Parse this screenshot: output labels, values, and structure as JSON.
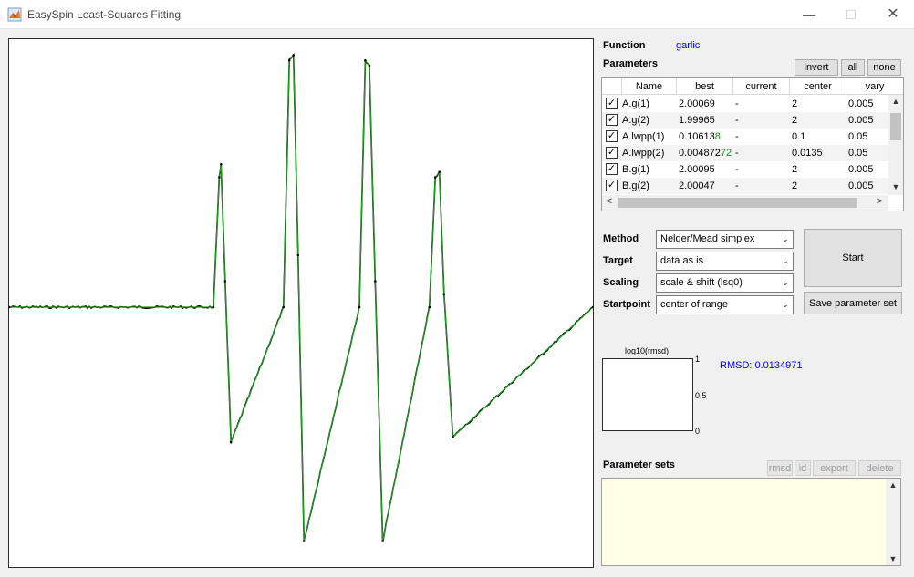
{
  "window": {
    "title": "EasySpin Least-Squares Fitting",
    "minimize": "—",
    "maximize": "☐",
    "close": "✕"
  },
  "function": {
    "label": "Function",
    "value": "garlic"
  },
  "parameters": {
    "label": "Parameters",
    "buttons": {
      "invert": "invert",
      "all": "all",
      "none": "none"
    },
    "columns": [
      "Name",
      "best",
      "current",
      "center",
      "vary"
    ],
    "rows": [
      {
        "checked": true,
        "name": "A.g(1)",
        "best": "2.00069",
        "best_changed": "",
        "current": "-",
        "center": "2",
        "vary": "0.005"
      },
      {
        "checked": true,
        "name": "A.g(2)",
        "best": "1.99965",
        "best_changed": "",
        "current": "-",
        "center": "2",
        "vary": "0.005"
      },
      {
        "checked": true,
        "name": "A.lwpp(1)",
        "best": "0.10613",
        "best_changed": "8",
        "current": "-",
        "center": "0.1",
        "vary": "0.05"
      },
      {
        "checked": true,
        "name": "A.lwpp(2)",
        "best": "0.004872",
        "best_changed": "72",
        "current": "-",
        "center": "0.0135",
        "vary": "0.05"
      },
      {
        "checked": true,
        "name": "B.g(1)",
        "best": "2.00095",
        "best_changed": "",
        "current": "-",
        "center": "2",
        "vary": "0.005"
      },
      {
        "checked": true,
        "name": "B.g(2)",
        "best": "2.00047",
        "best_changed": "",
        "current": "-",
        "center": "2",
        "vary": "0.005"
      }
    ]
  },
  "settings": {
    "method": {
      "label": "Method",
      "value": "Nelder/Mead simplex"
    },
    "target": {
      "label": "Target",
      "value": "data as is"
    },
    "scaling": {
      "label": "Scaling",
      "value": "scale & shift (lsq0)"
    },
    "startpoint": {
      "label": "Startpoint",
      "value": "center of range"
    }
  },
  "actions": {
    "start": "Start",
    "save": "Save parameter set"
  },
  "rmsd_plot": {
    "title": "log10(rmsd)",
    "ticks": [
      "1",
      "0.5",
      "0"
    ],
    "readout": "RMSD: 0.0134971"
  },
  "parameter_sets": {
    "label": "Parameter sets",
    "buttons": {
      "rmsd": "rmsd",
      "id": "id",
      "export": "export",
      "delete": "delete"
    }
  },
  "icons": {
    "app": "matlab-logo-icon",
    "check": "✓",
    "chevron_down": "⌄",
    "arrow_up": "▲",
    "arrow_down": "▼",
    "arrow_left": "<",
    "arrow_right": ">"
  },
  "colors": {
    "fit": "#1e9e1e",
    "data": "#000000",
    "blue_text": "#0000ff",
    "changed_digits": "#1a8a1a",
    "psets_bg": "#ffffe8"
  },
  "chart_data": {
    "type": "line",
    "title": "",
    "xlabel": "",
    "ylabel": "",
    "grid": false,
    "series": [
      {
        "x": [
          0,
          0.35,
          0.36,
          0.363,
          0.37,
          0.38,
          0.47,
          0.48,
          0.487,
          0.495,
          0.505,
          0.6,
          0.61,
          0.617,
          0.627,
          0.64,
          0.72,
          0.73,
          0.737,
          0.745,
          0.76,
          1
        ],
        "y": [
          0,
          0,
          0.5,
          0.55,
          0.1,
          -0.52,
          0,
          0.95,
          0.97,
          0.2,
          -0.9,
          0,
          0.95,
          0.93,
          0.1,
          -0.9,
          0,
          0.5,
          0.52,
          0.05,
          -0.5,
          0
        ]
      }
    ]
  }
}
